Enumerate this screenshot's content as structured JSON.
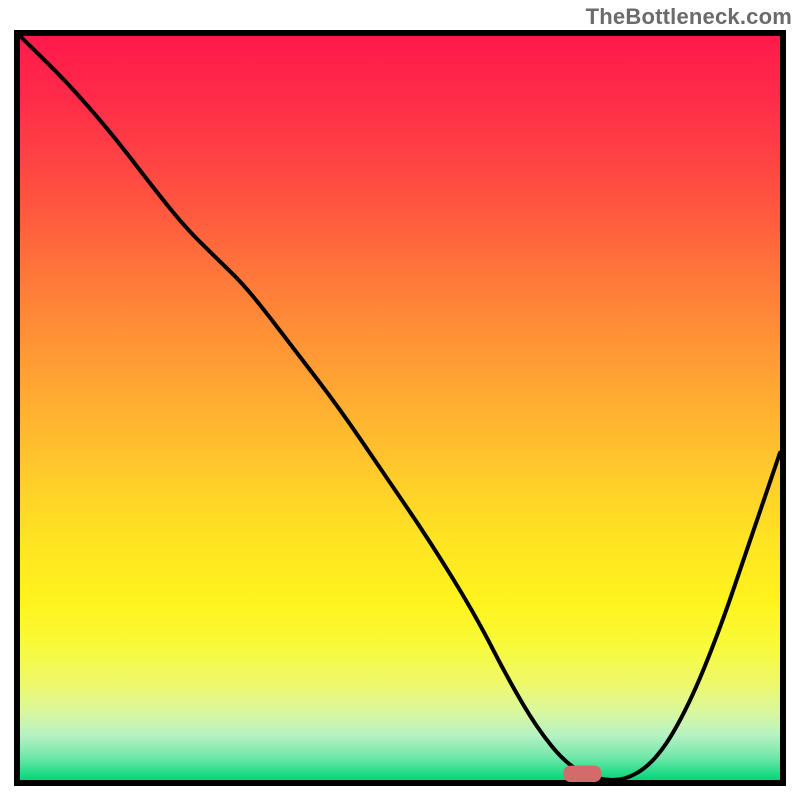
{
  "watermark": "TheBottleneck.com",
  "chart_data": {
    "type": "line",
    "title": "",
    "xlabel": "",
    "ylabel": "",
    "xlim": [
      0,
      100
    ],
    "ylim": [
      0,
      100
    ],
    "grid": false,
    "legend": null,
    "background": "rainbow-gradient-red-to-green",
    "series": [
      {
        "name": "bottleneck-curve",
        "x": [
          0,
          6,
          12,
          18,
          22,
          26,
          30,
          36,
          42,
          48,
          54,
          60,
          64,
          68,
          72,
          76,
          80,
          84,
          88,
          92,
          96,
          100
        ],
        "y": [
          100,
          94,
          87,
          79,
          74,
          70,
          66,
          58,
          50,
          41,
          32,
          22,
          14,
          7,
          2,
          0,
          0,
          3,
          10,
          20,
          32,
          44
        ]
      }
    ],
    "marker": {
      "name": "optimal-point",
      "shape": "rounded-rect",
      "x": 74,
      "y": 0,
      "color": "#d46a6a",
      "width_pct": 5,
      "height_pct": 2.2
    }
  }
}
